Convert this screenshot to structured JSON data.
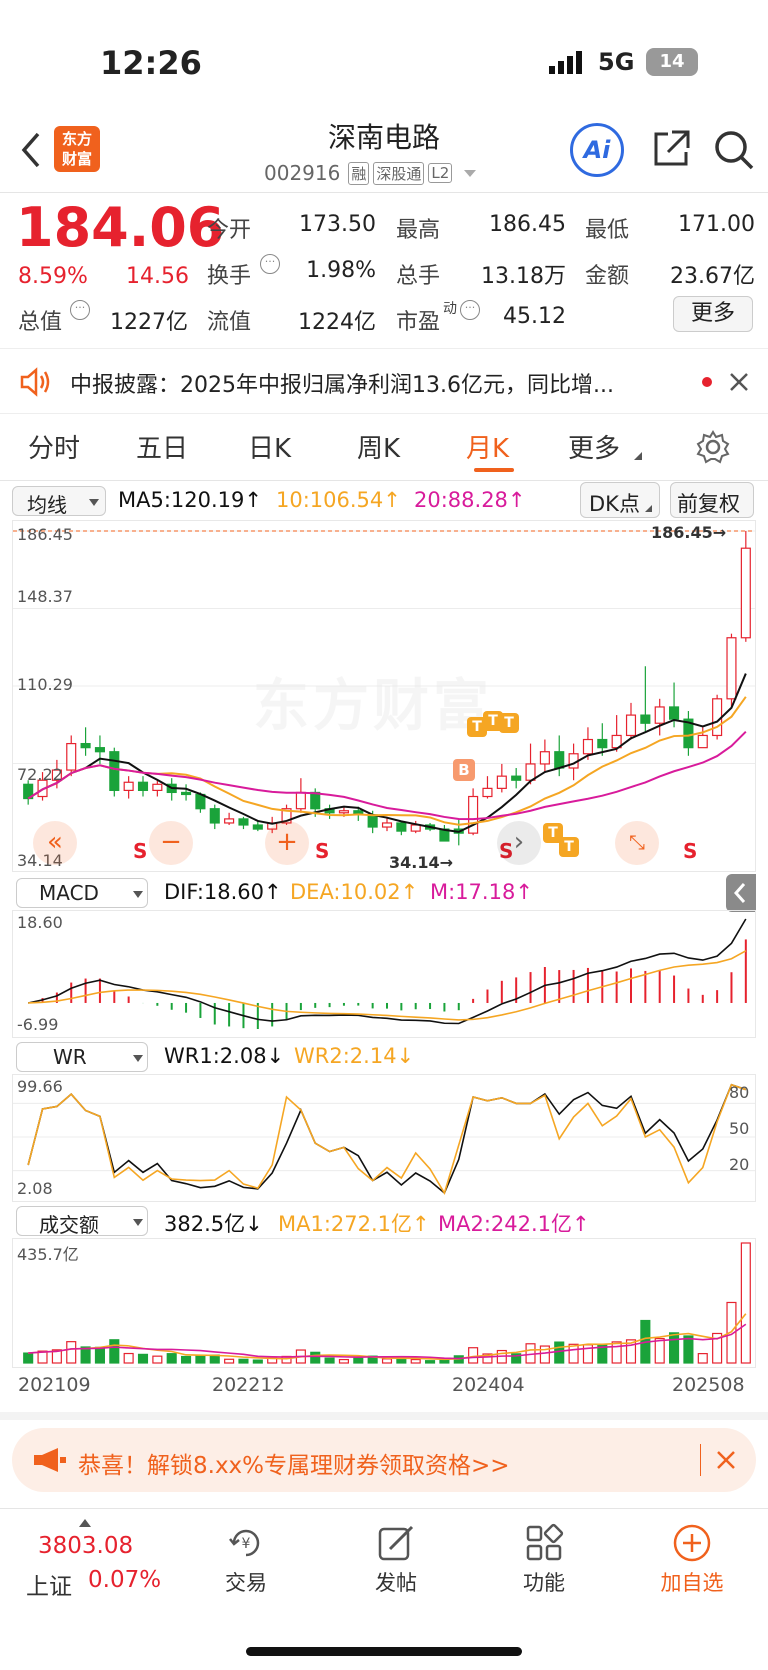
{
  "status_bar": {
    "time": "12:26",
    "network": "5G",
    "battery": "14"
  },
  "header": {
    "stock_name": "深南电路",
    "stock_code": "002916",
    "tags": [
      "融",
      "深股通",
      "L2"
    ],
    "logo_line1": "东方",
    "logo_line2": "财富",
    "ai_label": "Ai"
  },
  "quote": {
    "price": "184.06",
    "change_pct": "8.59%",
    "change_amt": "14.56",
    "fields": {
      "open_label": "今开",
      "open": "173.50",
      "high_label": "最高",
      "high": "186.45",
      "low_label": "最低",
      "low": "171.00",
      "turnover_label": "换手",
      "turnover": "1.98%",
      "volume_label": "总手",
      "volume": "13.18万",
      "amount_label": "金额",
      "amount": "23.67亿",
      "mktcap_label": "总值",
      "mktcap": "1227亿",
      "float_label": "流值",
      "float": "1224亿",
      "pe_label": "市盈",
      "pe_sup": "动",
      "pe": "45.12"
    },
    "more_button": "更多"
  },
  "notice": {
    "text": "中报披露：2025年中报归属净利润13.6亿元，同比增..."
  },
  "tabs": [
    "分时",
    "五日",
    "日K",
    "周K",
    "月K",
    "更多"
  ],
  "active_tab": "月K",
  "chart_toolbar": {
    "ma_select": "均线",
    "ma5": "MA5:120.19↑",
    "ma10": "10:106.54↑",
    "ma20": "20:88.28↑",
    "dk_button": "DK点",
    "adjust_button": "前复权"
  },
  "main_axis": {
    "top": "186.45",
    "l2": "148.37",
    "l3": "110.29",
    "l4": "72.22",
    "bottom": "34.14"
  },
  "annotations": {
    "high_mark": "186.45→",
    "low_mark": "34.14→",
    "buy": "B",
    "sell_t": "T",
    "sell_s": "S"
  },
  "macd": {
    "select": "MACD",
    "dif": "DIF:18.60↑",
    "dea": "DEA:10.02↑",
    "m": "M:17.18↑",
    "axis_top": "18.60",
    "axis_bottom": "-6.99"
  },
  "wr": {
    "select": "WR",
    "wr1": "WR1:2.08↓",
    "wr2": "WR2:2.14↓",
    "axis_top": "99.66",
    "axis_bottom": "2.08",
    "r80": "80",
    "r50": "50",
    "r20": "20"
  },
  "volume": {
    "select": "成交额",
    "value": "382.5亿↓",
    "ma1": "MA1:272.1亿↑",
    "ma2": "MA2:242.1亿↑",
    "axis_top": "435.7亿"
  },
  "dates": [
    "202109",
    "202212",
    "202404",
    "202508"
  ],
  "promo": {
    "text": "恭喜！解锁8.xx%专属理财券领取资格>>"
  },
  "bottom_nav": {
    "index_value": "3803.08",
    "index_name": "上证",
    "index_change": "0.07%",
    "trade": "交易",
    "post": "发帖",
    "func": "功能",
    "add": "加自选"
  },
  "watermark": "东方财富",
  "colors": {
    "up": "#e6222e",
    "down": "#1aa33a",
    "accent": "#f0611d",
    "ma5": "#111111",
    "ma10": "#f5a623",
    "ma20": "#d81b9b"
  },
  "chart_data": {
    "type": "candlestick",
    "period": "monthly",
    "ylim": [
      34.14,
      186.45
    ],
    "candles": [
      [
        62,
        55,
        64,
        52
      ],
      [
        56,
        64,
        68,
        54
      ],
      [
        64,
        69,
        74,
        60
      ],
      [
        69,
        82,
        86,
        66
      ],
      [
        82,
        80,
        90,
        76
      ],
      [
        80,
        78,
        86,
        72
      ],
      [
        78,
        59,
        80,
        56
      ],
      [
        59,
        63,
        66,
        55
      ],
      [
        63,
        59,
        66,
        56
      ],
      [
        59,
        62,
        64,
        56
      ],
      [
        62,
        58,
        65,
        54
      ],
      [
        58,
        57,
        62,
        54
      ],
      [
        57,
        50,
        58,
        48
      ],
      [
        50,
        43,
        52,
        40
      ],
      [
        43,
        45,
        48,
        42
      ],
      [
        45,
        42,
        46,
        40
      ],
      [
        42,
        40,
        44,
        39
      ],
      [
        40,
        43,
        46,
        38
      ],
      [
        43,
        50,
        52,
        42
      ],
      [
        50,
        58,
        65,
        48
      ],
      [
        58,
        50,
        60,
        46
      ],
      [
        50,
        48,
        52,
        45
      ],
      [
        48,
        49,
        51,
        46
      ],
      [
        49,
        47,
        51,
        44
      ],
      [
        47,
        41,
        49,
        38
      ],
      [
        41,
        43,
        46,
        39
      ],
      [
        43,
        39,
        44,
        37
      ],
      [
        39,
        42,
        44,
        38
      ],
      [
        42,
        40,
        43,
        39
      ],
      [
        40,
        34.14,
        42,
        34.14
      ],
      [
        40,
        38,
        45,
        32
      ],
      [
        38,
        56,
        60,
        37
      ],
      [
        56,
        60,
        66,
        55
      ],
      [
        60,
        66,
        72,
        58
      ],
      [
        66,
        64,
        70,
        60
      ],
      [
        64,
        72,
        82,
        62
      ],
      [
        72,
        78,
        84,
        68
      ],
      [
        78,
        70,
        86,
        66
      ],
      [
        70,
        77,
        82,
        64
      ],
      [
        77,
        84,
        90,
        74
      ],
      [
        84,
        80,
        92,
        76
      ],
      [
        80,
        86,
        96,
        78
      ],
      [
        86,
        96,
        102,
        84
      ],
      [
        96,
        92,
        120,
        88
      ],
      [
        92,
        100,
        104,
        86
      ],
      [
        100,
        94,
        112,
        90
      ],
      [
        94,
        80,
        98,
        76
      ],
      [
        80,
        86,
        90,
        82
      ],
      [
        86,
        104,
        106,
        84
      ],
      [
        104,
        134,
        136,
        100
      ],
      [
        134,
        178,
        186.45,
        132
      ]
    ],
    "ma5_label": "MA5",
    "ma10_label": "10",
    "ma20_label": "20"
  }
}
